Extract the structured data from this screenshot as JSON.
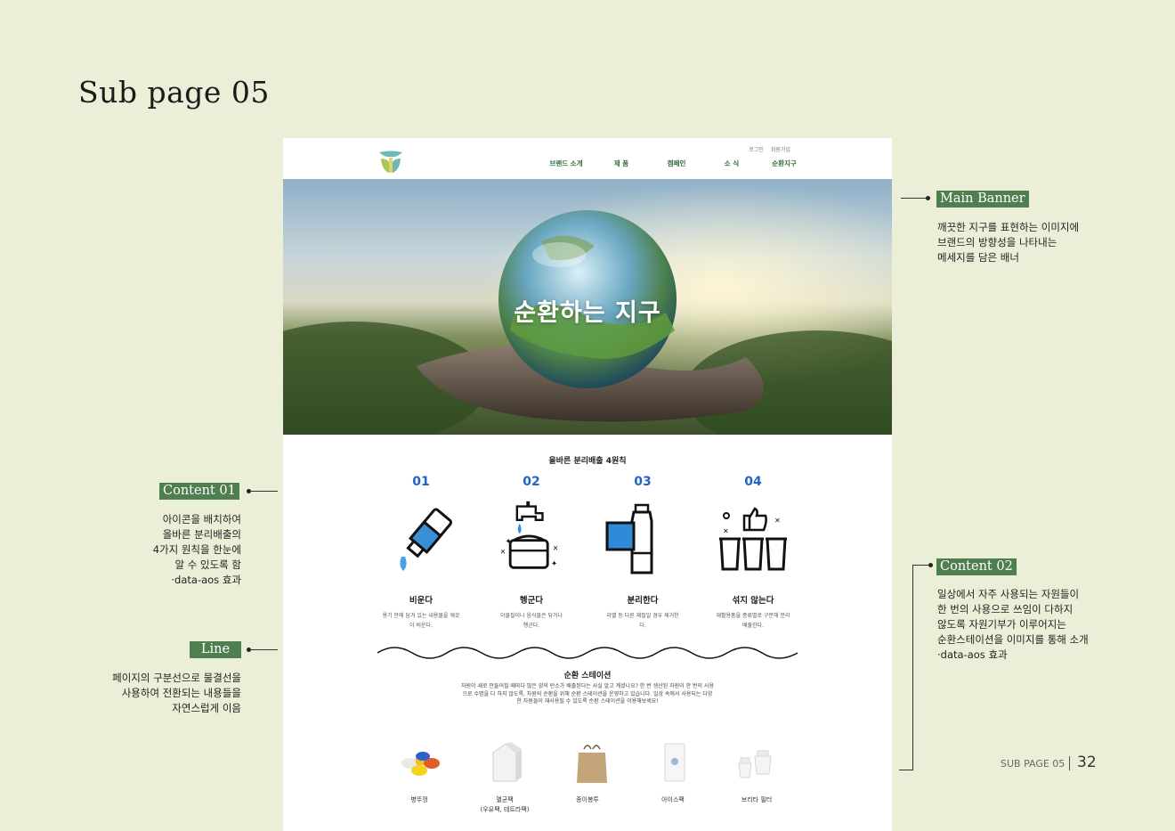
{
  "page_title": "Sub page 05",
  "site": {
    "util_nav": [
      "로그인",
      "회원가입"
    ],
    "main_nav": [
      "브랜드 소개",
      "제 품",
      "캠페인",
      "소 식",
      "순환지구"
    ],
    "banner_title": "순환하는 지구",
    "rules_heading": "올바른 분리배출 4원칙",
    "rules": [
      {
        "num": "01",
        "title": "비운다",
        "desc": "용기 안에 담겨 있는 내용물을 깨끗이 비운다.",
        "icon": "bottle-pour-icon"
      },
      {
        "num": "02",
        "title": "헹군다",
        "desc": "이물질이나 음식물은 닦거나 헹군다.",
        "icon": "faucet-rinse-icon"
      },
      {
        "num": "03",
        "title": "분리한다",
        "desc": "라벨 등 다른 재질일 경우 제거한다.",
        "icon": "bottle-label-icon"
      },
      {
        "num": "04",
        "title": "섞지 않는다",
        "desc": "재활용품을 종류별로 구분해 분리배출한다.",
        "icon": "recycle-bins-icon"
      }
    ],
    "station_heading": "순환 스테이션",
    "station_desc": "자원이 새로 만들어질 때마다 많은 양의 탄소가 배출된다는 사실 알고 계셨나요? 한 번 생산된 자원이 한 번의 사용으로 수명을 다 하지 않도록, 자원의 순환을 위해 순환 스테이션을 운영하고 있습니다. 일상 속에서 사용되는 다양한 자원들이 재사용될 수 있도록 순환 스테이션을 이용해보세요!",
    "station_items": [
      {
        "label": "병뚜껑",
        "sub": "",
        "icon": "bottle-caps-icon"
      },
      {
        "label": "멸균팩",
        "sub": "(우유팩, 테트라팩)",
        "icon": "milk-carton-icon"
      },
      {
        "label": "종이봉투",
        "sub": "",
        "icon": "paper-bag-icon"
      },
      {
        "label": "아이스팩",
        "sub": "",
        "icon": "ice-pack-icon"
      },
      {
        "label": "브리타 필터",
        "sub": "",
        "icon": "brita-filter-icon"
      }
    ]
  },
  "annotations": {
    "main_banner": {
      "tag": "Main Banner",
      "lines": [
        "깨끗한 지구를 표현하는 이미지에",
        "브랜드의 방향성을 나타내는",
        "메세지를 담은 배너"
      ]
    },
    "content01": {
      "tag": "Content 01",
      "lines": [
        "아이콘을 배치하여",
        "올바른 분리배출의",
        "4가지 원칙을 한눈에",
        "알 수 있도록 함",
        "·data-aos 효과"
      ]
    },
    "line": {
      "tag": "Line",
      "lines": [
        "페이지의 구분선으로  물결선을",
        "사용하여 전환되는 내용들을",
        "자연스럽게 이음"
      ]
    },
    "content02": {
      "tag": "Content 02",
      "lines": [
        "일상에서 자주 사용되는 자원들이",
        "한 번의 사용으로 쓰임이 다하지",
        "않도록 자원기부가 이루어지는",
        "순환스테이션을 이미지를 통해 소개",
        "·data-aos 효과"
      ]
    }
  },
  "footer": {
    "label": "SUB PAGE 05",
    "page_num": "32"
  },
  "colors": {
    "accent_green": "#4f7f4e",
    "nav_green": "#2f6b3a",
    "number_blue": "#2462c9",
    "background": "#ecefd8"
  }
}
